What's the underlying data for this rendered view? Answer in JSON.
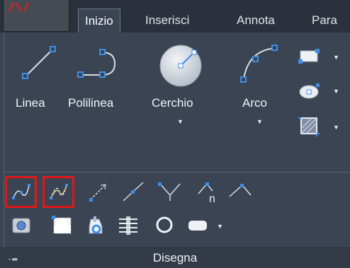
{
  "tabs": [
    {
      "label": "Inizio",
      "active": true
    },
    {
      "label": "Inserisci",
      "active": false
    },
    {
      "label": "Annota",
      "active": false
    },
    {
      "label": "Para",
      "active": false
    }
  ],
  "draw_tools": [
    {
      "label": "Linea",
      "icon": "line-icon"
    },
    {
      "label": "Polilinea",
      "icon": "polyline-icon"
    },
    {
      "label": "Cerchio",
      "icon": "circle-icon"
    },
    {
      "label": "Arco",
      "icon": "arc-icon"
    }
  ],
  "panel_title": "Disegna",
  "highlight_color": "#e01818",
  "accent_color": "#3f8ee8",
  "row2_icons": [
    "spline-fit-icon",
    "spline-cv-icon",
    "ray-icon",
    "construction-line-icon",
    "multiline-icon",
    "hatch-n-icon",
    "divide-icon"
  ],
  "row3_icons": [
    "region-icon",
    "wipeout-icon",
    "revision-cloud-icon",
    "donut-icon",
    "ellipse-icon",
    "more-icon"
  ],
  "row3_extra_label": "n"
}
